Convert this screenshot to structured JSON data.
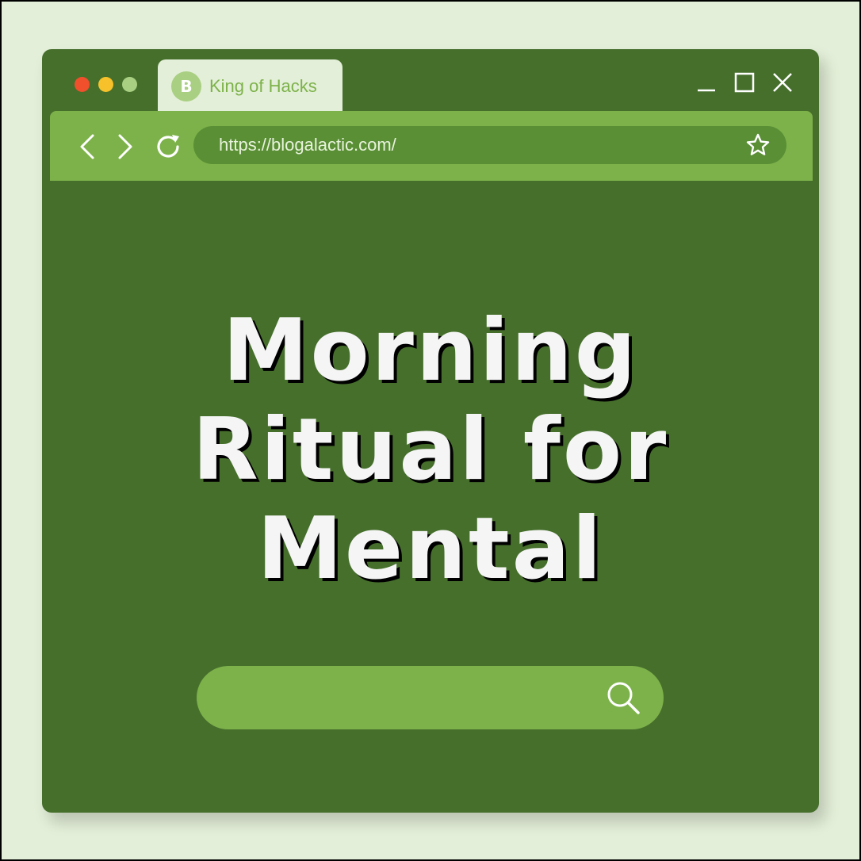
{
  "colors": {
    "background": "#e3efd8",
    "window": "#466f2c",
    "toolbar": "#7db24a",
    "address_bar": "#5a8f36",
    "close_dot": "#f0502c",
    "minimize_dot": "#f6c12a",
    "maximize_dot": "#a9cf82",
    "headline": "#f5f5f5"
  },
  "tab": {
    "favicon_letter": "B",
    "title": "King of Hacks"
  },
  "window_controls": {
    "icons": [
      "minimize-icon",
      "maximize-icon",
      "close-icon"
    ]
  },
  "toolbar": {
    "icons": [
      "back-icon",
      "forward-icon",
      "reload-icon"
    ],
    "url": "https://blogalactic.com/",
    "bookmark_icon": "star-icon"
  },
  "content": {
    "headline_lines": [
      "Morning",
      "Ritual for",
      "Mental"
    ]
  },
  "search": {
    "icon": "search-icon",
    "value": ""
  }
}
